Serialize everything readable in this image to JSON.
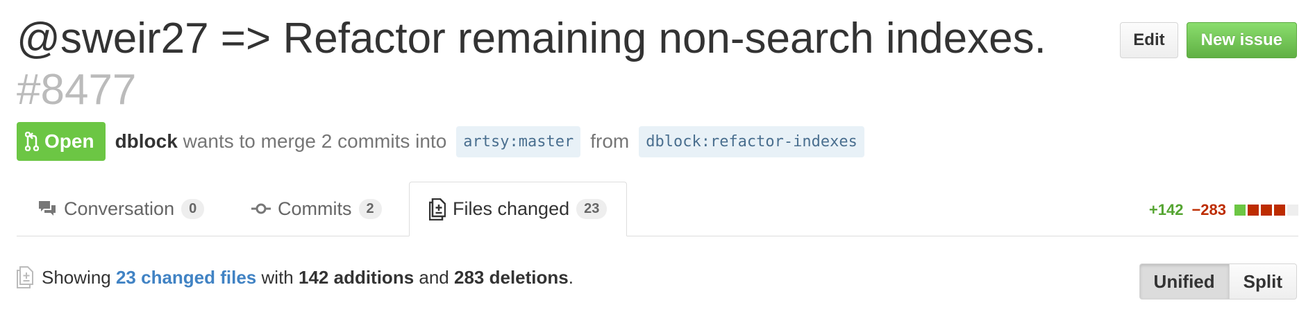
{
  "header": {
    "title": "@sweir27 => Refactor remaining non-search indexes.",
    "number": "#8477",
    "edit_label": "Edit",
    "new_issue_label": "New issue"
  },
  "meta": {
    "state": "Open",
    "author": "dblock",
    "merge_text": "wants to merge 2 commits into",
    "base_branch": "artsy:master",
    "from_text": "from",
    "head_branch": "dblock:refactor-indexes"
  },
  "tabs": [
    {
      "label": "Conversation",
      "count": "0",
      "icon": "comment-discussion-icon",
      "selected": false
    },
    {
      "label": "Commits",
      "count": "2",
      "icon": "git-commit-icon",
      "selected": false
    },
    {
      "label": "Files changed",
      "count": "23",
      "icon": "file-diff-icon",
      "selected": true
    }
  ],
  "diffstat": {
    "additions": "+142",
    "deletions": "−283",
    "blocks": [
      "added",
      "deleted",
      "deleted",
      "deleted",
      "neutral"
    ],
    "colors": {
      "added": "#6cc644",
      "deleted": "#bd2c00",
      "neutral": "#eeeeee"
    }
  },
  "summary": {
    "prefix": "Showing",
    "files_link": "23 changed files",
    "with_text": "with",
    "additions": "142 additions",
    "and_text": "and",
    "deletions": "283 deletions",
    "suffix": "."
  },
  "view_toggle": {
    "unified_label": "Unified",
    "split_label": "Split",
    "selected": "Unified"
  }
}
